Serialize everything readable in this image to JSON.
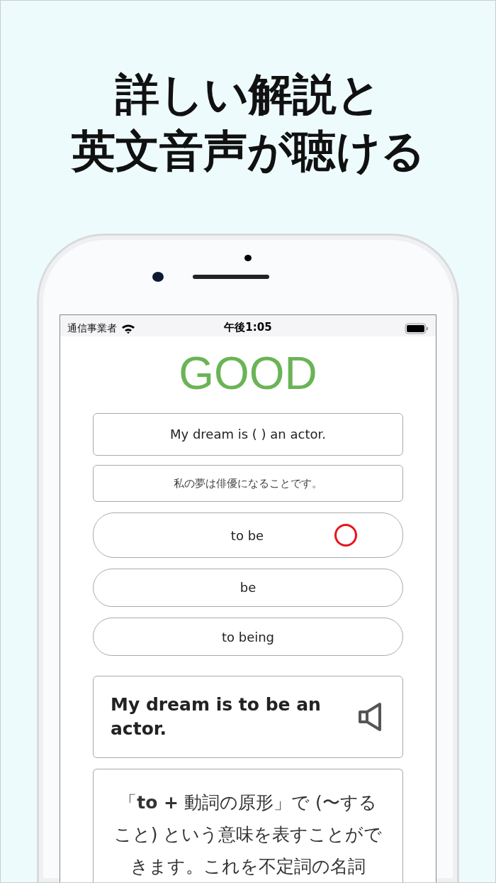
{
  "headline": [
    "詳しい解説と",
    "英文音声が聴ける"
  ],
  "status_bar": {
    "carrier": "通信事業者",
    "time": "午後1:05"
  },
  "result": "GOOD",
  "question": {
    "sentence": "My dream is ( ) an actor.",
    "translation": "私の夢は俳優になることです。"
  },
  "options": [
    {
      "label": "to be",
      "correct": true
    },
    {
      "label": "be",
      "correct": false
    },
    {
      "label": "to being",
      "correct": false
    }
  ],
  "answer": {
    "sentence": "My dream is to be an actor."
  },
  "explanation": "「**to +** 動詞の原形」で (〜すること) という意味を表すことができます。これを不定詞の名詞"
}
